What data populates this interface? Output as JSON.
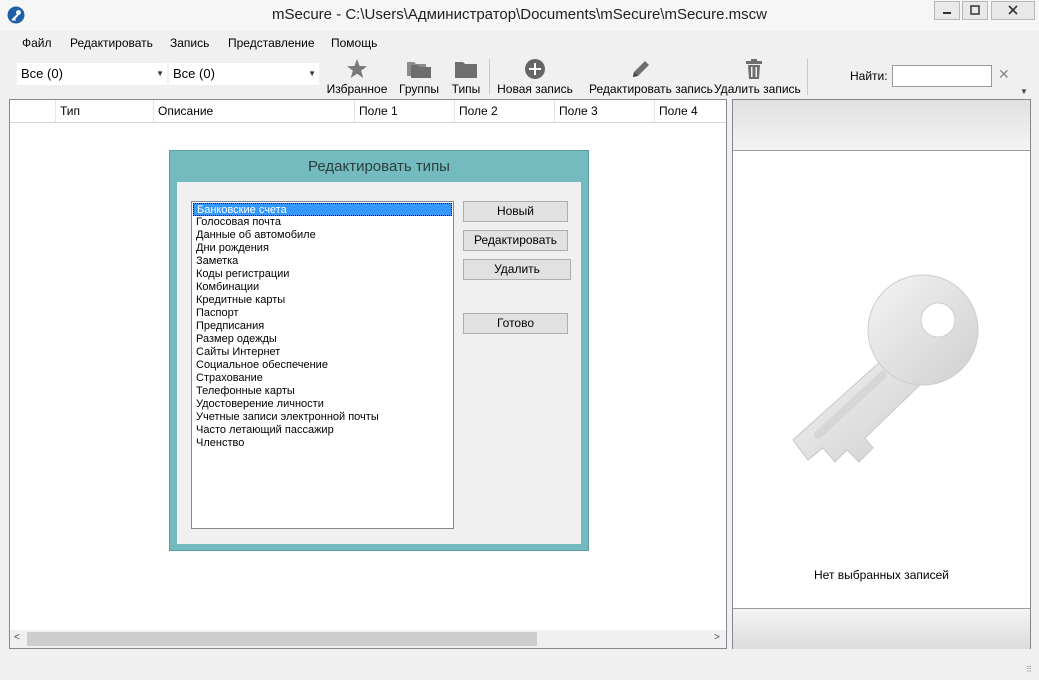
{
  "window": {
    "title": "mSecure - C:\\Users\\Администратор\\Documents\\mSecure\\mSecure.mscw",
    "icon": "key-app-icon",
    "controls": {
      "minimize_icon": "minimize-icon",
      "maximize_icon": "maximize-icon",
      "close_icon": "close-icon"
    }
  },
  "menu": {
    "items": [
      "Файл",
      "Редактировать",
      "Запись",
      "Представление",
      "Помощь"
    ]
  },
  "toolbar": {
    "filter1": {
      "value": "Все (0)"
    },
    "filter2": {
      "value": "Все (0)"
    },
    "buttons": [
      {
        "label": "Избранное",
        "icon": "star-icon"
      },
      {
        "label": "Группы",
        "icon": "folders-icon"
      },
      {
        "label": "Типы",
        "icon": "folder-icon"
      },
      {
        "label": "Новая запись",
        "icon": "plus-circle-icon"
      },
      {
        "label": "Редактировать запись",
        "icon": "pencil-icon"
      },
      {
        "label": "Удалить запись",
        "icon": "trash-icon"
      }
    ],
    "find_label": "Найти:",
    "find_value": "",
    "find_clear": "✕"
  },
  "list": {
    "columns": [
      "Тип",
      "Описание",
      "Поле 1",
      "Поле 2",
      "Поле 3",
      "Поле 4"
    ]
  },
  "dialog": {
    "title": "Редактировать типы",
    "types": [
      "Банковские счета",
      "Голосовая почта",
      "Данные об автомобиле",
      "Дни рождения",
      "Заметка",
      "Коды регистрации",
      "Комбинации",
      "Кредитные карты",
      "Паспорт",
      "Предписания",
      "Размер одежды",
      "Сайты Интернет",
      "Социальное обеспечение",
      "Страхование",
      "Телефонные карты",
      "Удостоверение личности",
      "Учетные записи электронной почты",
      "Часто летающий пассажир",
      "Членство"
    ],
    "selected_index": 0,
    "buttons": {
      "new": "Новый",
      "edit": "Редактировать",
      "delete": "Удалить",
      "done": "Готово"
    }
  },
  "preview": {
    "empty_text": "Нет выбранных записей",
    "art_icon": "key-icon"
  },
  "colors": {
    "dialog_frame": "#74bbc0",
    "selection": "#3399ff"
  }
}
